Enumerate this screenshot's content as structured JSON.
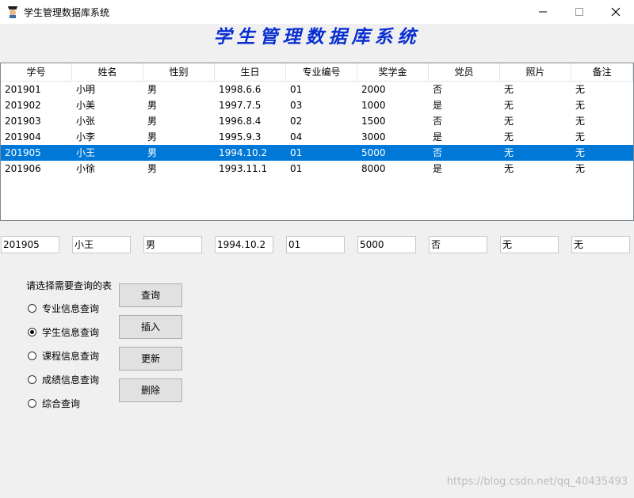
{
  "window": {
    "title": "学生管理数据库系统",
    "icon": "student-app-icon"
  },
  "banner": {
    "title": "学生管理数据库系统"
  },
  "grid": {
    "columns": [
      "学号",
      "姓名",
      "性别",
      "生日",
      "专业编号",
      "奖学金",
      "党员",
      "照片",
      "备注"
    ],
    "rows": [
      [
        "201901",
        "小明",
        "男",
        "1998.6.6",
        "01",
        "2000",
        "否",
        "无",
        "无"
      ],
      [
        "201902",
        "小美",
        "男",
        "1997.7.5",
        "03",
        "1000",
        "是",
        "无",
        "无"
      ],
      [
        "201903",
        "小张",
        "男",
        "1996.8.4",
        "02",
        "1500",
        "否",
        "无",
        "无"
      ],
      [
        "201904",
        "小李",
        "男",
        "1995.9.3",
        "04",
        "3000",
        "是",
        "无",
        "无"
      ],
      [
        "201905",
        "小王",
        "男",
        "1994.10.2",
        "01",
        "5000",
        "否",
        "无",
        "无"
      ],
      [
        "201906",
        "小徐",
        "男",
        "1993.11.1",
        "01",
        "8000",
        "是",
        "无",
        "无"
      ]
    ],
    "selected_row": 4,
    "selection_color": "#0078d7"
  },
  "edit_fields": [
    "201905",
    "小王",
    "男",
    "1994.10.2",
    "01",
    "5000",
    "否",
    "无",
    "无"
  ],
  "query_group": {
    "label": "请选择需要查询的表",
    "options": [
      "专业信息查询",
      "学生信息查询",
      "课程信息查询",
      "成绩信息查询",
      "综合查询"
    ],
    "selected": 1
  },
  "buttons": {
    "query": "查询",
    "insert": "插入",
    "update": "更新",
    "delete": "删除"
  },
  "watermark": "https://blog.csdn.net/qq_40435493",
  "colors": {
    "banner": "#0a2fd1",
    "background": "#f0f0f0"
  }
}
